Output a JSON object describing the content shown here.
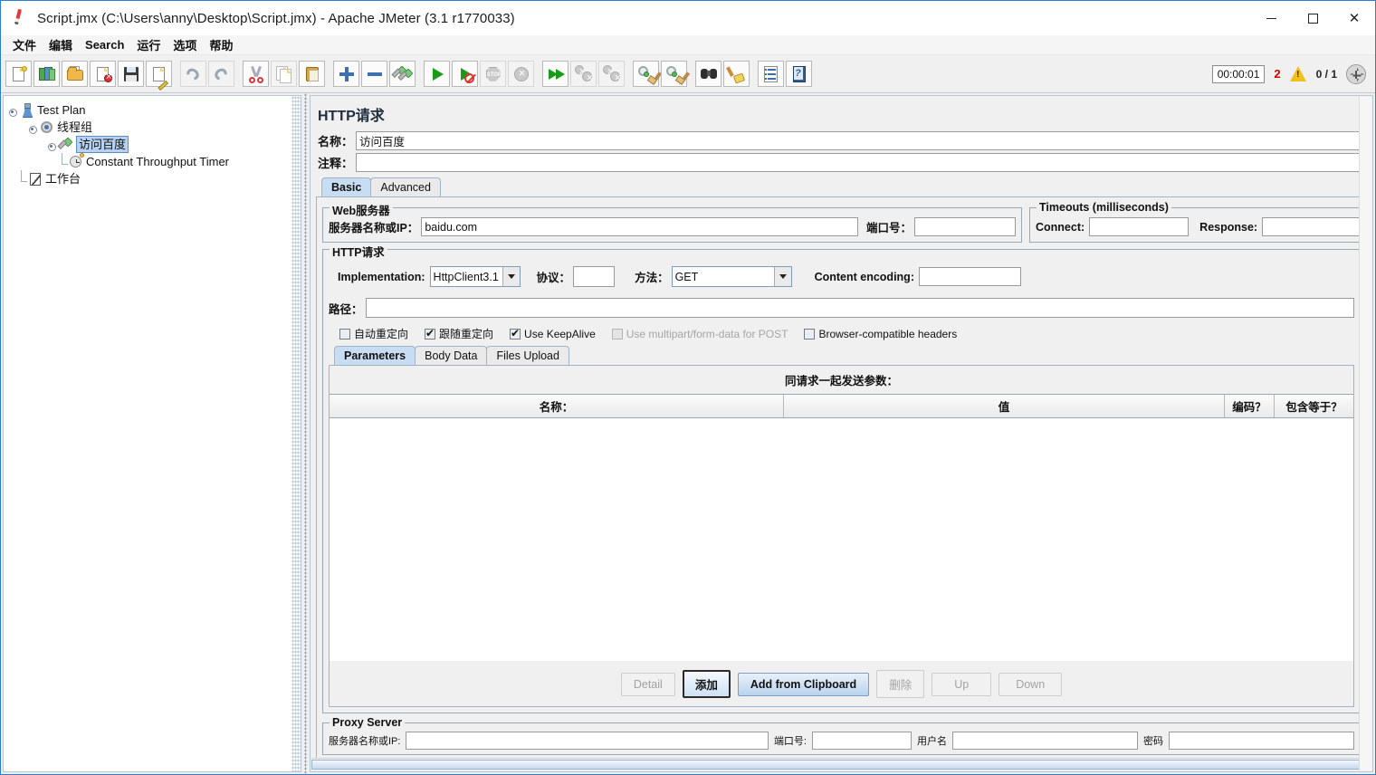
{
  "window": {
    "title": "Script.jmx (C:\\Users\\anny\\Desktop\\Script.jmx) - Apache JMeter (3.1 r1770033)",
    "app_icon": "jmeter-feather-icon",
    "minimize": "—",
    "maximize": "□",
    "close": "✕"
  },
  "menubar": {
    "items": [
      {
        "label": "文件"
      },
      {
        "label": "编辑"
      },
      {
        "label": "Search"
      },
      {
        "label": "运行"
      },
      {
        "label": "选项"
      },
      {
        "label": "帮助"
      }
    ]
  },
  "toolbar": {
    "groups": [
      [
        "new-icon",
        "templates-icon",
        "open-icon",
        "close-file-icon",
        "save-icon",
        "save-as-icon"
      ],
      [
        "undo-icon",
        "redo-icon"
      ],
      [
        "cut-icon",
        "copy-icon",
        "paste-icon"
      ],
      [
        "expand-icon",
        "collapse-icon",
        "toggle-icon"
      ],
      [
        "start-icon",
        "start-no-timers-icon",
        "stop-icon",
        "shutdown-icon"
      ],
      [
        "remote-start-all-icon",
        "remote-stop-all-icon",
        "remote-shutdown-all-icon"
      ],
      [
        "clear-icon",
        "clear-all-icon"
      ],
      [
        "search-icon",
        "search-reset-icon"
      ],
      [
        "function-helper-icon",
        "help-icon"
      ]
    ],
    "status": {
      "elapsed_time": "00:00:01",
      "error_count": "2",
      "warning_icon": "warning-triangle-icon",
      "threads": "0 / 1",
      "target_icon": "connection-status-icon"
    }
  },
  "tree": {
    "nodes": [
      {
        "label": "Test Plan",
        "icon": "test-plan-icon",
        "depth": 0,
        "selected": false
      },
      {
        "label": "线程组",
        "icon": "thread-group-icon",
        "depth": 1,
        "selected": false
      },
      {
        "label": "访问百度",
        "icon": "http-sampler-icon",
        "depth": 2,
        "selected": true
      },
      {
        "label": "Constant Throughput Timer",
        "icon": "timer-icon",
        "depth": 3,
        "selected": false
      },
      {
        "label": "工作台",
        "icon": "workbench-icon",
        "depth": 0,
        "selected": false
      }
    ]
  },
  "main": {
    "title": "HTTP请求",
    "name_label": "名称：",
    "name_value": "访问百度",
    "comment_label": "注释：",
    "comment_value": "",
    "tabs": [
      {
        "label": "Basic",
        "active": true
      },
      {
        "label": "Advanced",
        "active": false
      }
    ],
    "web_server": {
      "title": "Web服务器",
      "server_label": "服务器名称或IP：",
      "server_value": "baidu.com",
      "port_label": "端口号：",
      "port_value": ""
    },
    "timeouts": {
      "title": "Timeouts (milliseconds)",
      "connect_label": "Connect:",
      "connect_value": "",
      "response_label": "Response:",
      "response_value": ""
    },
    "http_request": {
      "title": "HTTP请求",
      "implementation_label": "Implementation:",
      "implementation_value": "HttpClient3.1",
      "protocol_label": "协议：",
      "protocol_value": "",
      "method_label": "方法：",
      "method_value": "GET",
      "content_encoding_label": "Content encoding:",
      "content_encoding_value": "",
      "path_label": "路径：",
      "path_value": "",
      "checkboxes": [
        {
          "label": "自动重定向",
          "checked": false,
          "disabled": false
        },
        {
          "label": "跟随重定向",
          "checked": true,
          "disabled": false
        },
        {
          "label": "Use KeepAlive",
          "checked": true,
          "disabled": false
        },
        {
          "label": "Use multipart/form-data for POST",
          "checked": false,
          "disabled": true
        },
        {
          "label": "Browser-compatible headers",
          "checked": false,
          "disabled": false
        }
      ]
    },
    "param_tabs": [
      {
        "label": "Parameters",
        "active": true
      },
      {
        "label": "Body Data",
        "active": false
      },
      {
        "label": "Files Upload",
        "active": false
      }
    ],
    "param_table": {
      "caption": "同请求一起发送参数：",
      "columns": [
        "名称：",
        "值",
        "编码？",
        "包含等于？"
      ],
      "rows": []
    },
    "param_buttons": [
      {
        "label": "Detail",
        "state": "disabled"
      },
      {
        "label": "添加",
        "state": "focused"
      },
      {
        "label": "Add from Clipboard",
        "state": "primary"
      },
      {
        "label": "删除",
        "state": "disabled"
      },
      {
        "label": "Up",
        "state": "disabled"
      },
      {
        "label": "Down",
        "state": "disabled"
      }
    ],
    "proxy_server": {
      "title": "Proxy Server",
      "server_label": "服务器名称或IP:",
      "server_value": "",
      "port_label": "端口号:",
      "port_value": "",
      "username_label": "用户名",
      "username_value": "",
      "password_label": "密码",
      "password_value": ""
    }
  },
  "colors": {
    "window_border": "#2b7cd3",
    "panel_bg": "#f0f0f0",
    "selection": "#b6d2ef",
    "error": "#d00000",
    "warning": "#f2c21a"
  }
}
